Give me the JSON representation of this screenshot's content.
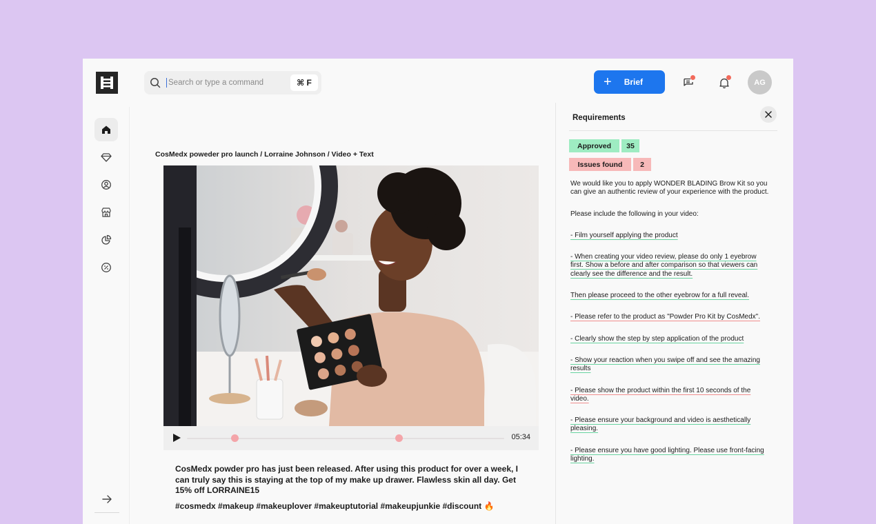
{
  "header": {
    "search_placeholder": "Search or type a command",
    "search_shortcut": "⌘ F",
    "brief_label": "Brief",
    "avatar_initials": "AG"
  },
  "sidebar": {
    "items": [
      {
        "icon": "home-icon",
        "active": true
      },
      {
        "icon": "diamond-icon",
        "active": false
      },
      {
        "icon": "user-icon",
        "active": false
      },
      {
        "icon": "store-icon",
        "active": false
      },
      {
        "icon": "pie-chart-icon",
        "active": false
      },
      {
        "icon": "discount-icon",
        "active": false
      }
    ],
    "bottom_icon": "arrow-right-icon"
  },
  "post": {
    "title": "CosMedx poweder pro launch / Lorraine Johnson / Video + Text",
    "video_duration": "05:34",
    "caption": "CosMedx powder pro has just been released.  After using this product for over a week, I can truly say this is staying at the top of my make up drawer. Flawless skin all day. Get 15% off LORRAINE15",
    "hashtags": "#cosmedx #makeup #makeuplover #makeuptutorial #makeupjunkie #discount 🔥"
  },
  "requirements": {
    "title": "Requirements",
    "approved_label": "Approved",
    "approved_count": "35",
    "issues_label": "Issues found",
    "issues_count": "2",
    "items": [
      {
        "text": "We would like you to apply WONDER BLADING Brow Kit so you can give an authentic review of your experience with the product.",
        "status": "none"
      },
      {
        "text": "Please include the following in your video:",
        "status": "none"
      },
      {
        "text": "- Film yourself applying the product",
        "status": "approved"
      },
      {
        "text": "- When creating your video review, please do only 1 eyebrow first. Show a before and after comparison so that viewers can clearly see the difference and the result.",
        "status": "approved"
      },
      {
        "text": "Then please proceed to the other eyebrow for a full reveal.",
        "status": "approved"
      },
      {
        "text": "- Please refer to the product as \"Powder Pro Kit by CosMedx\".",
        "status": "issue"
      },
      {
        "text": "- Clearly show the step by step application of the product",
        "status": "approved"
      },
      {
        "text": "- Show your reaction when you swipe off and see the amazing results",
        "status": "approved"
      },
      {
        "text": "- Please show the product within the first 10 seconds of the video.",
        "status": "issue"
      },
      {
        "text": "- Please ensure your background and video is aesthetically pleasing.",
        "status": "approved"
      },
      {
        "text": "- Please ensure you have good lighting. Please use front-facing lighting.",
        "status": "approved"
      }
    ]
  },
  "colors": {
    "accent": "#1d76ee",
    "approved": "#9eecc2",
    "issue": "#f7b9b9",
    "background": "#dcc6f2"
  }
}
